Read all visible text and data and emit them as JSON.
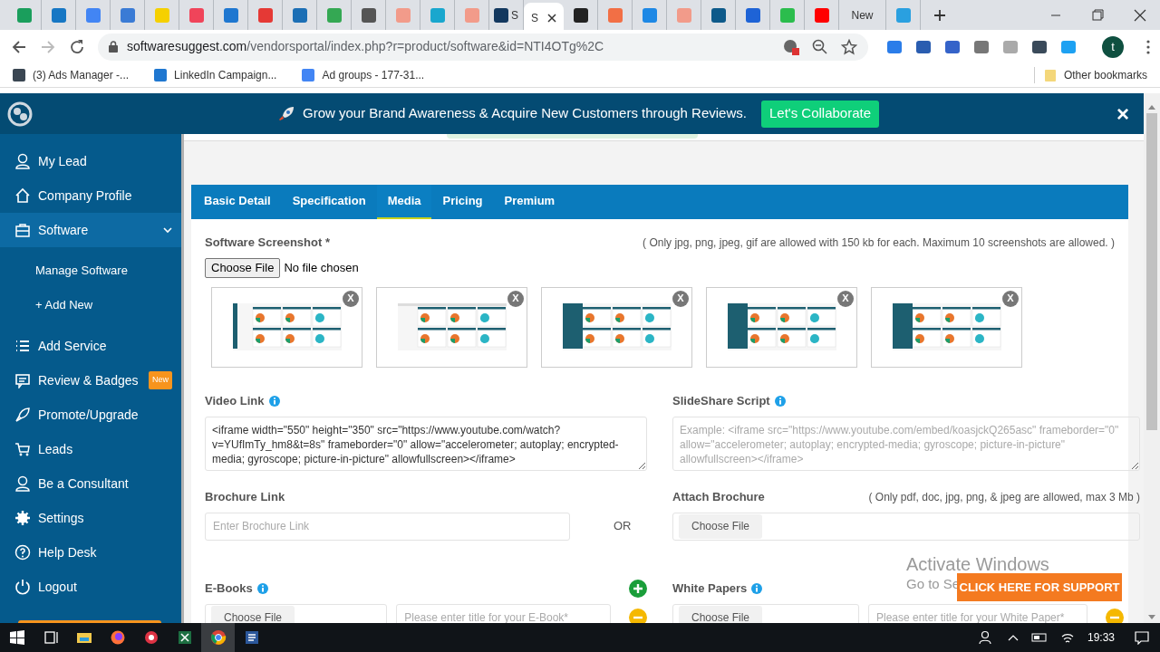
{
  "browser": {
    "tabs": [
      {
        "color": "#1a9e5c",
        "selected": false
      },
      {
        "color": "#1777c4",
        "selected": false
      },
      {
        "color": "#4285f4",
        "selected": false
      },
      {
        "color": "#3a7bd5",
        "selected": false
      },
      {
        "color": "#f5d000",
        "selected": false
      },
      {
        "color": "#f0445a",
        "selected": false
      },
      {
        "color": "#1f77d0",
        "selected": false
      },
      {
        "color": "#e53935",
        "selected": false
      },
      {
        "color": "#1c6fb5",
        "selected": false
      },
      {
        "color": "#34a853",
        "selected": false
      },
      {
        "color": "#555555",
        "selected": false
      },
      {
        "color": "#f29b8a",
        "selected": false
      },
      {
        "color": "#19a7ce",
        "selected": false
      },
      {
        "color": "#f29b8a",
        "selected": false
      },
      {
        "color": "#13385f",
        "label": "S",
        "selected": false
      },
      {
        "label": "S",
        "selected": true
      },
      {
        "color": "#222222",
        "selected": false
      },
      {
        "color": "#f26f45",
        "selected": false
      },
      {
        "color": "#1e88e5",
        "selected": false
      },
      {
        "color": "#f29b8a",
        "selected": false
      },
      {
        "color": "#0e5a8a",
        "selected": false
      },
      {
        "color": "#1e63d6",
        "selected": false
      },
      {
        "color": "#2bbd4d",
        "selected": false
      },
      {
        "color": "#ff0000",
        "selected": false
      },
      {
        "label": "New",
        "selected": false
      },
      {
        "color": "#2aa0e0",
        "selected": false
      }
    ],
    "url_domain": "softwaresuggest.com",
    "url_path": "/vendorsportal/index.php?r=product/software&id=NTI4OTg%2C",
    "profile_initial": "t",
    "bookmarks": [
      "(3) Ads Manager -...",
      "LinkedIn Campaign...",
      "Ad groups - 177-31..."
    ],
    "other_bookmarks": "Other bookmarks"
  },
  "banner": {
    "text": "Grow your Brand Awareness & Acquire New Customers through Reviews.",
    "button": "Let's Collaborate",
    "close": "×"
  },
  "sidebar": {
    "items": [
      {
        "label": "My Lead",
        "selected": false
      },
      {
        "label": "Company Profile",
        "selected": false
      },
      {
        "label": "Software",
        "selected": true,
        "expanded": true,
        "children": [
          {
            "label": "Manage Software"
          },
          {
            "label": "+ Add New"
          }
        ]
      },
      {
        "label": "Add Service",
        "selected": false
      },
      {
        "label": "Review & Badges",
        "badge": "New",
        "selected": false
      },
      {
        "label": "Promote/Upgrade",
        "selected": false
      },
      {
        "label": "Leads",
        "selected": false
      },
      {
        "label": "Be a Consultant",
        "selected": false
      },
      {
        "label": "Settings",
        "selected": false
      },
      {
        "label": "Help Desk",
        "selected": false
      },
      {
        "label": "Logout",
        "selected": false
      }
    ]
  },
  "form": {
    "tabs": [
      {
        "label": "Basic Detail",
        "selected": false
      },
      {
        "label": "Specification",
        "selected": false
      },
      {
        "label": "Media",
        "selected": true
      },
      {
        "label": "Pricing",
        "selected": false
      },
      {
        "label": "Premium",
        "selected": false
      }
    ],
    "screenshot_label": "Software Screenshot *",
    "screenshot_note": "( Only jpg, png, jpeg, gif are allowed with 150 kb for each. Maximum 10 screenshots are allowed. )",
    "file_button": "Choose File",
    "file_status": "No file chosen",
    "screenshots": [
      {
        "remove": "X"
      },
      {
        "remove": "X"
      },
      {
        "remove": "X"
      },
      {
        "remove": "X"
      },
      {
        "remove": "X"
      }
    ],
    "video_label": "Video Link",
    "video_value": "<iframe width=\"550\" height=\"350\" src=\"https://www.youtube.com/watch?v=YUfImTy_hm8&t=8s\" frameborder=\"0\" allow=\"accelerometer; autoplay; encrypted-media; gyroscope; picture-in-picture\" allowfullscreen></iframe>",
    "slideshare_label": "SlideShare Script",
    "slideshare_placeholder": "Example: <iframe src=\"https://www.youtube.com/embed/koasjckQ265asc\" frameborder=\"0\" allow=\"accelerometer; autoplay; encrypted-media; gyroscope; picture-in-picture\" allowfullscreen></iframe>",
    "brochure_label": "Brochure Link",
    "brochure_placeholder": "Enter Brochure Link",
    "or": "OR",
    "attach_label": "Attach Brochure",
    "attach_note": "( Only pdf, doc, jpg, png, & jpeg are allowed, max 3 Mb )",
    "attach_button": "Choose File",
    "ebooks_label": "E-Books",
    "ebooks_button": "Choose File",
    "ebooks_placeholder": "Please enter title for your E-Book*",
    "papers_label": "White Papers",
    "papers_button": "Choose File",
    "papers_placeholder": "Please enter title for your White Paper*"
  },
  "support_button": "CLICK HERE FOR SUPPORT",
  "activation": {
    "title": "Activate Windows",
    "subtitle": "Go to Se"
  },
  "taskbar": {
    "time": "19:33"
  }
}
